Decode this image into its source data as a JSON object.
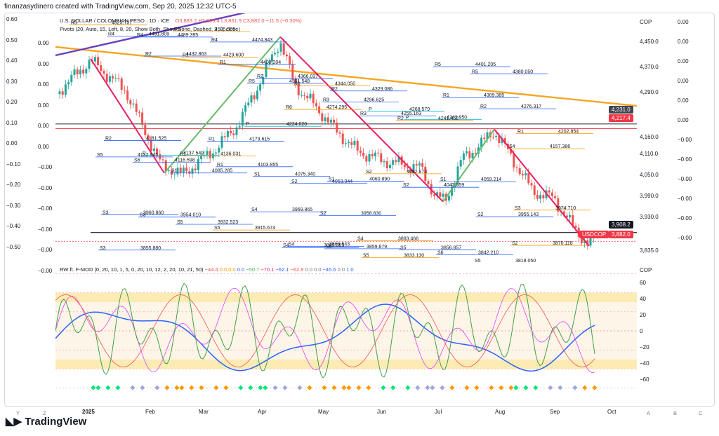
{
  "header": {
    "caption": "finanzasydinero created with TradingView.com, Sep 20, 2025 12:32 UTC-5"
  },
  "legend": {
    "symbol": "U.S. DOLLAR / COLOMBIAN PESO · 1D · ICE",
    "ohlc": "O3,883.2 H3,909.4 L3,861.9 C3,882.0 −11.5 (−0.30%)",
    "pivots": "Pivots (20, Auto, 15, Left, 8, 20, Show Both, Show None, Dashed, 2, 3, close)",
    "osc": "RW ft. F-MOD (0, 20, 10, 1, 5, 0, 20, 10, 12, 2, 20, 10, 21, 50)",
    "osc_values": [
      "−44.4",
      "0.0",
      "0.0",
      "0.0",
      "−50.7",
      "−70.1",
      "−62.1",
      "−62.8",
      "0.0",
      "0.0",
      "−45.6",
      "0.0",
      "1.0"
    ]
  },
  "currency": "COP",
  "osc_currency": "COP",
  "price_axis": [
    "4,450.0",
    "4,370.0",
    "4,290.0",
    "4,160.0",
    "4,110.0",
    "4,050.0",
    "3,990.0",
    "3,930.0",
    "3,835.0"
  ],
  "price_tags": {
    "level1": "4,231.0",
    "level2": "4,217.4",
    "level3": "3,908.2",
    "symbol": "USDCOP",
    "last": "3,882.0"
  },
  "osc_axis": [
    "60",
    "40",
    "20",
    "0",
    "−20",
    "−40",
    "−60"
  ],
  "left_axis_1": [
    "0.60",
    "0.50",
    "0.40",
    "0.30",
    "0.20",
    "0.10",
    "0.00",
    "−0.10",
    "−0.20",
    "−0.30",
    "−0.40",
    "−0.50"
  ],
  "left_axis_2": [
    "0.00",
    "0.00",
    "0.00",
    "0.00",
    "0.00",
    "0.00",
    "−0.00",
    "−0.00",
    "−0.00",
    "−0.00",
    "−0.00",
    "−0.00"
  ],
  "right_axis_2": [
    "0.00",
    "0.00",
    "0.00",
    "0.00",
    "0.00",
    "0.00",
    "−0.00",
    "−0.00",
    "−0.00",
    "−0.00",
    "−0.00",
    "−0.00"
  ],
  "x_axis": [
    "2025",
    "Feb",
    "Mar",
    "Apr",
    "May",
    "Jun",
    "Jul",
    "Aug",
    "Sep",
    "Oct"
  ],
  "corners": [
    "Y",
    "Z",
    "A",
    "B",
    "C"
  ],
  "pivot_levels": [
    {
      "label": "R5",
      "value": "4525.737"
    },
    {
      "label": "R4",
      "value": "4491.809"
    },
    {
      "label": "R2",
      "value": "4432.863"
    },
    {
      "label": "R1",
      "value": "4429.600"
    },
    {
      "label": "R1",
      "value": "4408.204"
    },
    {
      "label": "R2",
      "value": "4366.037"
    },
    {
      "label": "R1",
      "value": "4344.050"
    },
    {
      "label": "R2",
      "value": "4329.086"
    },
    {
      "label": "P",
      "value": "4268.579"
    },
    {
      "label": "P",
      "value": "4243.950"
    },
    {
      "label": "R1",
      "value": "4309.385"
    },
    {
      "label": "R2",
      "value": "4276.317"
    },
    {
      "label": "R1",
      "value": "4202.854"
    },
    {
      "label": "R2",
      "value": "4181.525"
    },
    {
      "label": "P",
      "value": "4137.549"
    },
    {
      "label": "R1",
      "value": "4136.031"
    },
    {
      "label": "R1",
      "value": "4103.855"
    },
    {
      "label": "S1",
      "value": "4075.340"
    },
    {
      "label": "S2",
      "value": "4053.944"
    },
    {
      "label": "S1",
      "value": "4060.890"
    },
    {
      "label": "S2",
      "value": "4082.873"
    },
    {
      "label": "S2",
      "value": "4042.659"
    },
    {
      "label": "S1",
      "value": "4059.214"
    },
    {
      "label": "S2",
      "value": "3955.143"
    },
    {
      "label": "S3",
      "value": "3974.710"
    },
    {
      "label": "S3",
      "value": "3960.860"
    },
    {
      "label": "S3",
      "value": "3954.010"
    },
    {
      "label": "S5",
      "value": "3932.523"
    },
    {
      "label": "S5",
      "value": "3915.674"
    },
    {
      "label": "S4",
      "value": "3969.865"
    },
    {
      "label": "S4",
      "value": "3866.543"
    },
    {
      "label": "S6",
      "value": "3859.879"
    },
    {
      "label": "S5",
      "value": "3833.130"
    },
    {
      "label": "S5",
      "value": "3856.857"
    },
    {
      "label": "S6",
      "value": "3842.210"
    },
    {
      "label": "S5",
      "value": "3818.050"
    },
    {
      "label": "S2",
      "value": "3870.118"
    },
    {
      "label": "S3",
      "value": "3855.880"
    },
    {
      "label": "R4",
      "value": "4489.395"
    },
    {
      "label": "R5",
      "value": "4505.505"
    },
    {
      "label": "R4",
      "value": "4474.843"
    },
    {
      "label": "R5",
      "value": "4351.548"
    },
    {
      "label": "R6",
      "value": "4274.295"
    },
    {
      "label": "R3",
      "value": "4296.625"
    },
    {
      "label": "R3",
      "value": "4255.163"
    },
    {
      "label": "R2",
      "value": "4241.452"
    },
    {
      "label": "R5",
      "value": "4401.205"
    },
    {
      "label": "R5",
      "value": "4380.050"
    },
    {
      "label": "S4",
      "value": "4157.386"
    },
    {
      "label": "S5",
      "value": "4132.945"
    },
    {
      "label": "S6",
      "value": "4116.598"
    },
    {
      "label": "S1",
      "value": "4085.285"
    },
    {
      "label": "R1",
      "value": "4179.615"
    },
    {
      "label": "P",
      "value": "4224.020"
    },
    {
      "label": "S4",
      "value": "3863.365"
    },
    {
      "label": "S2",
      "value": "3958.830"
    },
    {
      "label": "S4",
      "value": "3883.466"
    }
  ],
  "colors": {
    "bull": "#26a69a",
    "bear": "#ef5350",
    "zigzag_up": "#66bb6a",
    "zigzag_down": "#e91e63",
    "trend": "#f5a623",
    "trend2": "#6a3fbf",
    "osc_blue": "#2962ff",
    "osc_band": "#fdeea8"
  }
}
